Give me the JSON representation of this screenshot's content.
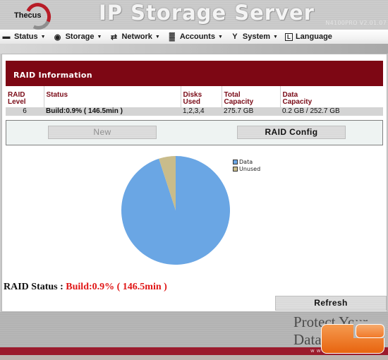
{
  "header": {
    "brand": "Thecus",
    "app_title": "IP Storage Server",
    "version": "N4100PRO V2.01.07"
  },
  "menu": [
    {
      "label": "Status",
      "icon": "status-icon",
      "glyph": "▬",
      "has_dropdown": true
    },
    {
      "label": "Storage",
      "icon": "storage-disc-icon",
      "glyph": "◉",
      "has_dropdown": true
    },
    {
      "label": "Network",
      "icon": "network-arrows-icon",
      "glyph": "⇄",
      "has_dropdown": true
    },
    {
      "label": "Accounts",
      "icon": "accounts-icon",
      "glyph": "▓",
      "has_dropdown": true
    },
    {
      "label": "System",
      "icon": "system-wrench-icon",
      "glyph": "Υ",
      "has_dropdown": true
    },
    {
      "label": "Language",
      "icon": "language-icon",
      "glyph": "L",
      "has_dropdown": false
    }
  ],
  "raid_info": {
    "title": "RAID Information",
    "columns": [
      {
        "line1": "RAID",
        "line2": "Level"
      },
      {
        "line1": "Status",
        "line2": ""
      },
      {
        "line1": "Disks",
        "line2": "Used"
      },
      {
        "line1": "Total",
        "line2": "Capacity"
      },
      {
        "line1": "Data",
        "line2": "Capacity"
      }
    ],
    "rows": [
      {
        "level": "6",
        "status": "Build:0.9% ( 146.5min )",
        "disks_used": "1,2,3,4",
        "total_capacity": "275.7 GB",
        "data_capacity": "0.2 GB / 252.7 GB"
      }
    ],
    "buttons": {
      "new": "New",
      "config": "RAID Config"
    }
  },
  "chart_data": {
    "type": "pie",
    "title": "",
    "categories": [
      "Data",
      "Unused"
    ],
    "values": [
      95,
      5
    ],
    "colors": [
      "#6aa6e4",
      "#c9bc8b"
    ],
    "start_angle": "12 o'clock, Unused slice counter-clockwise from top",
    "legend": {
      "placement": "top-right",
      "entries": [
        "Data",
        "Unused"
      ]
    }
  },
  "raid_status": {
    "label": "RAID Status :",
    "value": "Build:0.9% ( 146.5min )",
    "value_color": "#e01515"
  },
  "refresh_label": "Refresh",
  "footer": {
    "slogan": "Protect Your Data",
    "url": "www.thecus.com"
  },
  "colors": {
    "raid_header_bg": "#7d0714",
    "column_header_text": "#7a0b17",
    "footer_bar": "#9b1a2d"
  }
}
